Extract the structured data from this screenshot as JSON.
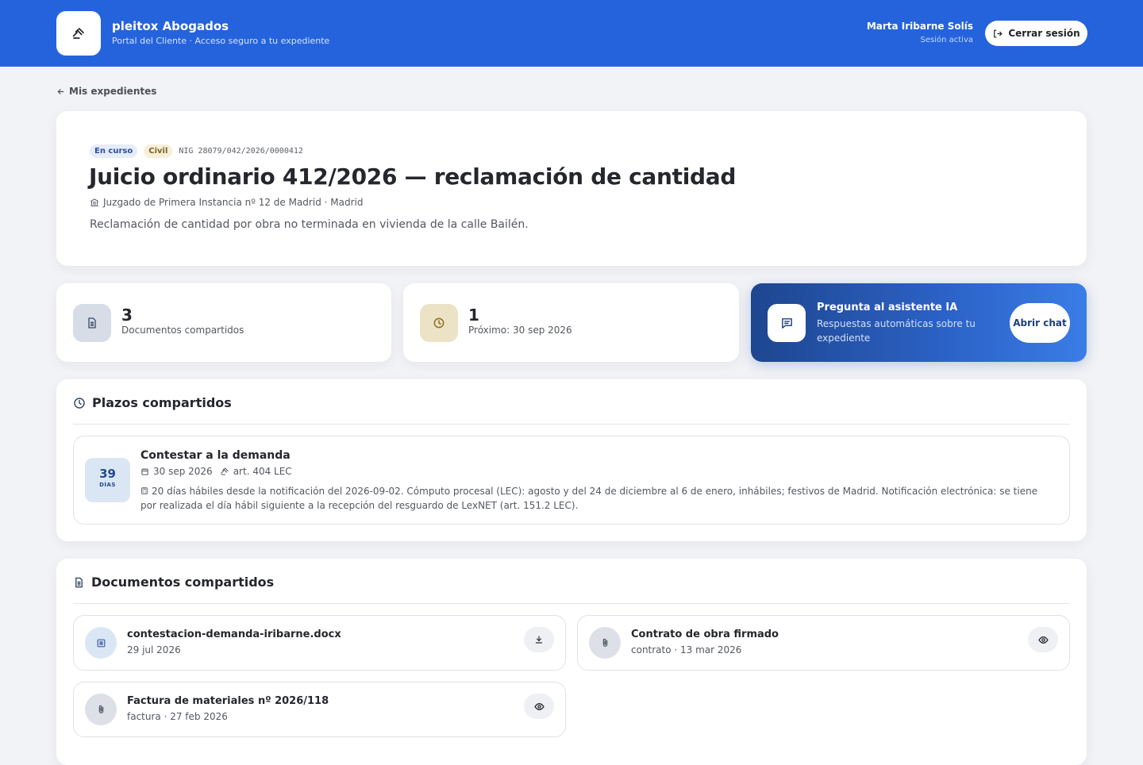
{
  "header": {
    "brand_name": "pleitox Abogados",
    "brand_tagline": "Portal del Cliente · Acceso seguro a tu expediente",
    "user_name": "Marta Iribarne Solís",
    "user_status": "Sesión activa",
    "logout_label": "Cerrar sesión"
  },
  "nav": {
    "back_label": "Mis expedientes"
  },
  "case": {
    "status_badge": "En curso",
    "type_badge": "Civil",
    "nig": "NIG 28079/042/2026/0000412",
    "title": "Juicio ordinario 412/2026 — reclamación de cantidad",
    "court": "Juzgado de Primera Instancia nº 12 de Madrid · Madrid",
    "description": "Reclamación de cantidad por obra no terminada en vivienda de la calle Bailén."
  },
  "stats": {
    "documents": {
      "value": "3",
      "label": "Documentos compartidos"
    },
    "deadlines": {
      "value": "1",
      "label": "Próximo: 30 sep 2026"
    }
  },
  "assistant": {
    "title": "Pregunta al asistente IA",
    "subtitle": "Respuestas automáticas sobre tu expediente",
    "button_label": "Abrir chat"
  },
  "plazos": {
    "heading": "Plazos compartidos",
    "items": [
      {
        "days": "39",
        "days_unit": "DÍAS",
        "title": "Contestar a la demanda",
        "date": "30 sep 2026",
        "article": "art. 404 LEC",
        "description": "20 días hábiles desde la notificación del 2026-09-02. Cómputo procesal (LEC): agosto y del 24 de diciembre al 6 de enero, inhábiles; festivos de Madrid. Notificación electrónica: se tiene por realizada el día hábil siguiente a la recepción del resguardo de LexNET (art. 151.2 LEC)."
      }
    ]
  },
  "documents": {
    "heading": "Documentos compartidos",
    "items": [
      {
        "title": "contestacion-demanda-iribarne.docx",
        "subtitle": "29 jul 2026",
        "action_icon": "download-icon"
      },
      {
        "title": "Contrato de obra firmado",
        "subtitle": "contrato · 13 mar 2026",
        "action_icon": "eye-icon"
      },
      {
        "title": "Factura de materiales nº 2026/118",
        "subtitle": "factura · 27 feb 2026",
        "action_icon": "eye-icon"
      }
    ]
  },
  "colors": {
    "primary": "#2563dd",
    "page_bg": "#f2f3f6",
    "assistant_gradient_start": "#1e4690",
    "assistant_gradient_end": "#3a7de6",
    "deadline_badge_bg": "#dbe6f5"
  }
}
